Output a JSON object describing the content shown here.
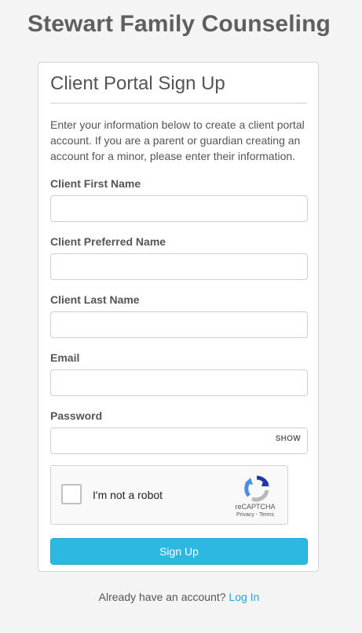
{
  "site": {
    "title": "Stewart Family Counseling"
  },
  "form": {
    "title": "Client Portal Sign Up",
    "intro": "Enter your information below to create a client portal account. If you are a parent or guardian creating an account for a minor, please enter their information.",
    "first_name": {
      "label": "Client First Name",
      "value": ""
    },
    "preferred_name": {
      "label": "Client Preferred Name",
      "value": ""
    },
    "last_name": {
      "label": "Client Last Name",
      "value": ""
    },
    "email": {
      "label": "Email",
      "value": ""
    },
    "password": {
      "label": "Password",
      "value": "",
      "show_label": "SHOW"
    },
    "captcha": {
      "label": "I'm not a robot",
      "brand": "reCAPTCHA",
      "links": "Privacy - Terms",
      "checked": false
    },
    "submit_label": "Sign Up"
  },
  "footer": {
    "prompt": "Already have an account?",
    "login_label": "Log In"
  },
  "colors": {
    "accent": "#2cb8e0",
    "link": "#23a3d6",
    "background": "#f4f4f4"
  }
}
